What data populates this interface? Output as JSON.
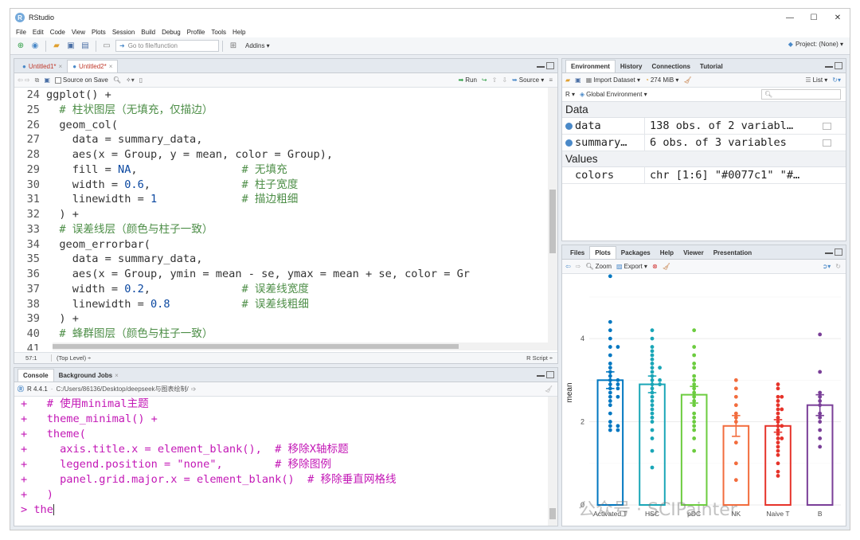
{
  "window": {
    "title": "RStudio"
  },
  "menu": [
    "File",
    "Edit",
    "Code",
    "View",
    "Plots",
    "Session",
    "Build",
    "Debug",
    "Profile",
    "Tools",
    "Help"
  ],
  "toolbar": {
    "goto_placeholder": "Go to file/function",
    "addins": "Addins ▾",
    "project": "Project: (None) ▾"
  },
  "source": {
    "tabs": [
      {
        "label": "Untitled1*"
      },
      {
        "label": "Untitled2*"
      }
    ],
    "toolbar": {
      "source_on_save": "Source on Save",
      "run": "Run",
      "source": "Source ▾"
    },
    "lines": [
      {
        "n": "24",
        "html": "<span class=\"code\">ggplot() +</span>"
      },
      {
        "n": "25",
        "html": "  <span class=\"cm\"># 柱状图层（无填充，仅描边）</span>"
      },
      {
        "n": "26",
        "html": "  geom_col("
      },
      {
        "n": "27",
        "html": "    data = summary_data,"
      },
      {
        "n": "28",
        "html": "    aes(x = Group, y = mean, color = Group),"
      },
      {
        "n": "29",
        "html": "    fill = <span class=\"num\">NA</span>,                <span class=\"cm\"># 无填充</span>"
      },
      {
        "n": "30",
        "html": "    width = <span class=\"num\">0.6</span>,              <span class=\"cm\"># 柱子宽度</span>"
      },
      {
        "n": "31",
        "html": "    linewidth = <span class=\"num\">1</span>             <span class=\"cm\"># 描边粗细</span>"
      },
      {
        "n": "32",
        "html": "  ) +"
      },
      {
        "n": "33",
        "html": "  <span class=\"cm\"># 误差线层（颜色与柱子一致）</span>"
      },
      {
        "n": "34",
        "html": "  geom_errorbar("
      },
      {
        "n": "35",
        "html": "    data = summary_data,"
      },
      {
        "n": "36",
        "html": "    aes(x = Group, ymin = mean - se, ymax = mean + se, color = Gr"
      },
      {
        "n": "37",
        "html": "    width = <span class=\"num\">0.2</span>,              <span class=\"cm\"># 误差线宽度</span>"
      },
      {
        "n": "38",
        "html": "    linewidth = <span class=\"num\">0.8</span>           <span class=\"cm\"># 误差线粗细</span>"
      },
      {
        "n": "39",
        "html": "  ) +"
      },
      {
        "n": "40",
        "html": "  <span class=\"cm\"># 蜂群图层（颜色与柱子一致）</span>"
      },
      {
        "n": "41",
        "html": ""
      }
    ],
    "status": {
      "pos": "57:1",
      "scope": "(Top Level) ÷",
      "type": "R Script ÷"
    }
  },
  "console": {
    "tabs": [
      "Console",
      "Background Jobs"
    ],
    "r_version": "R 4.4.1",
    "path": "C:/Users/86136/Desktop/deepseek与图表绘制/",
    "lines": [
      "+   # 使用minimal主题",
      "+   theme_minimal() +",
      "+   theme(",
      "+     axis.title.x = element_blank(),  # 移除X轴标题",
      "+     legend.position = \"none\",        # 移除图例",
      "+     panel.grid.major.x = element_blank()  # 移除垂直网格线",
      "+   )",
      "> the"
    ]
  },
  "environment": {
    "tabs": [
      "Environment",
      "History",
      "Connections",
      "Tutorial"
    ],
    "toolbar": {
      "import": "Import Dataset ▾",
      "memory": "274 MiB ▾",
      "list": "List ▾"
    },
    "scope": "Global Environment ▾",
    "r_label": "R ▾",
    "data_header": "Data",
    "values_header": "Values",
    "data": [
      {
        "name": "data",
        "value": "138 obs. of 2 variabl…"
      },
      {
        "name": "summary…",
        "value": "6 obs. of 3 variables"
      }
    ],
    "values": [
      {
        "name": "colors",
        "value": "chr [1:6] \"#0077c1\" \"#…"
      }
    ]
  },
  "plots": {
    "tabs": [
      "Files",
      "Plots",
      "Packages",
      "Help",
      "Viewer",
      "Presentation"
    ],
    "toolbar": {
      "zoom": "Zoom",
      "export": "Export ▾"
    }
  },
  "chart_data": {
    "type": "bar",
    "ylabel": "mean",
    "ylim": [
      0,
      5.4
    ],
    "yticks": [
      0,
      2,
      4
    ],
    "categories": [
      "Activated T",
      "HSC",
      "pDC",
      "NK",
      "Naive T",
      "B"
    ],
    "values": [
      3.0,
      2.9,
      2.65,
      1.9,
      1.9,
      2.4
    ],
    "errors": [
      0.2,
      0.2,
      0.2,
      0.25,
      0.15,
      0.25
    ],
    "colors": [
      "#0077c1",
      "#1aa6b7",
      "#6ccc3f",
      "#f26c3d",
      "#e6332a",
      "#7a3f98"
    ],
    "points": [
      [
        5.5,
        4.4,
        4.2,
        4.0,
        3.8,
        3.8,
        3.6,
        3.4,
        3.3,
        3.2,
        3.1,
        3.0,
        2.9,
        2.9,
        2.8,
        2.8,
        2.7,
        2.6,
        2.5,
        2.4,
        2.2,
        2.0,
        1.9,
        1.8,
        1.8,
        1.9,
        2.6,
        3.0
      ],
      [
        4.2,
        4.0,
        3.8,
        3.7,
        3.6,
        3.5,
        3.4,
        3.3,
        3.2,
        3.1,
        3.0,
        3.0,
        2.9,
        2.8,
        2.7,
        2.6,
        2.5,
        2.4,
        2.3,
        2.2,
        2.1,
        2.0,
        1.8,
        1.6,
        1.3,
        0.9,
        2.9,
        3.3
      ],
      [
        4.2,
        3.8,
        3.6,
        3.4,
        3.3,
        3.0,
        2.9,
        2.8,
        2.7,
        2.6,
        2.5,
        2.4,
        2.2,
        2.1,
        2.0,
        1.9,
        1.8,
        1.6,
        1.3,
        3.1
      ],
      [
        3.0,
        2.8,
        2.6,
        2.4,
        2.2,
        2.0,
        1.5,
        1.0,
        0.6,
        2.1
      ],
      [
        2.9,
        2.8,
        2.6,
        2.5,
        2.4,
        2.3,
        2.2,
        2.1,
        2.0,
        1.9,
        1.8,
        1.7,
        1.6,
        1.5,
        1.4,
        1.3,
        1.2,
        1.0,
        0.8,
        0.7,
        2.3,
        1.9,
        2.6,
        1.6
      ],
      [
        4.1,
        3.2,
        2.7,
        2.5,
        2.4,
        2.2,
        2.0,
        1.8,
        1.6,
        1.4,
        2.6,
        2.1
      ]
    ]
  },
  "watermark": "公众号 · SCIPainter"
}
